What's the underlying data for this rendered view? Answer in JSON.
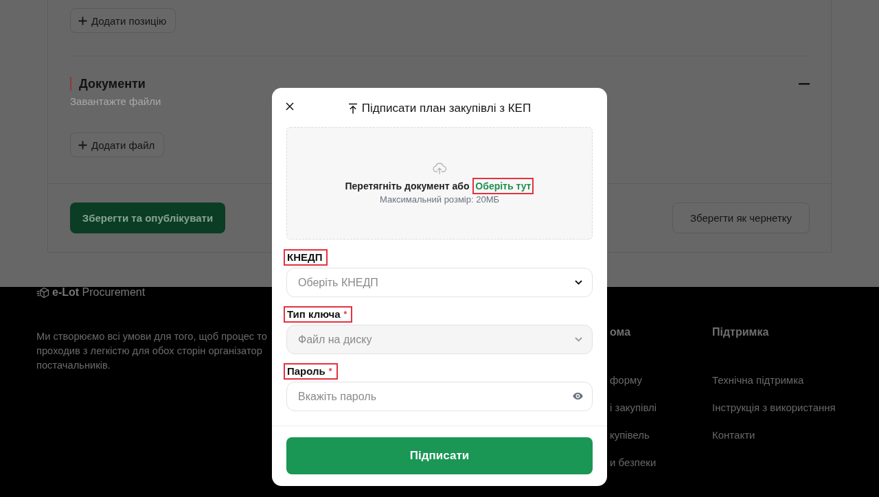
{
  "page": {
    "add_position_button": "Додати позицію",
    "documents_section": {
      "title": "Документи",
      "subtitle": "Завантажте файли",
      "expanded": true,
      "add_file_button": "Додати файл"
    },
    "actions": {
      "publish_button": "Зберегти та опублікувати",
      "draft_button": "Зберегти як чернетку"
    }
  },
  "footer": {
    "logo_text": "**e-Lot** Procurement",
    "description_lines": [
      "Ми створюємо всі умови для того, щоб процес то",
      "проходив з легкістю для обох сторін організатор",
      "постачальників."
    ],
    "columns": [
      {
        "heading": "ома",
        "links": [
          "форму",
          "і закупівлі",
          "купівель",
          "и безпеки"
        ]
      },
      {
        "heading": "Підтримка",
        "links": [
          "Технічна підтримка",
          "Інструкція з використання",
          "Контакти"
        ]
      }
    ]
  },
  "modal": {
    "title": "Підписати план закупівлі з КЕП",
    "dropzone": {
      "text": "Перетягніть документ або",
      "link": {
        "label": "Оберіть тут",
        "highlighted": true
      },
      "hint": "Максимальний розмір: 20МБ"
    },
    "fields": [
      {
        "kind": "select",
        "label": "КНЕДП",
        "highlighted": true,
        "disabled": false,
        "placeholder": "Оберіть КНЕДП"
      },
      {
        "kind": "select",
        "label": "Тип ключа",
        "required_mark": "*",
        "highlighted": true,
        "disabled": true,
        "value": "Файл на диску"
      },
      {
        "kind": "password",
        "label": "Пароль",
        "required_mark": "*",
        "highlighted": true,
        "disabled": false,
        "placeholder": "Вкажіть пароль"
      }
    ],
    "submit_button": "Підписати"
  }
}
